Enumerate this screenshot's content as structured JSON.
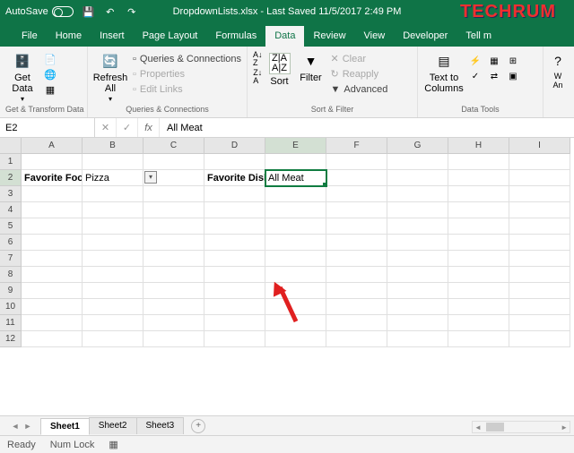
{
  "title": {
    "autosave": "AutoSave",
    "filename": "DropdownLists.xlsx - Last Saved 11/5/2017 2:49 PM"
  },
  "watermark": "TECHRUM",
  "tabs": [
    "File",
    "Home",
    "Insert",
    "Page Layout",
    "Formulas",
    "Data",
    "Review",
    "View",
    "Developer",
    "Tell m"
  ],
  "activeTab": "Data",
  "ribbon": {
    "transform": {
      "label": "Get & Transform Data",
      "get": "Get\nData"
    },
    "queries": {
      "label": "Queries & Connections",
      "refresh": "Refresh\nAll",
      "items": [
        "Queries & Connections",
        "Properties",
        "Edit Links"
      ]
    },
    "sort": {
      "label": "Sort & Filter",
      "sort": "Sort",
      "filter": "Filter",
      "clear": "Clear",
      "reapply": "Reapply",
      "adv": "Advanced"
    },
    "tools": {
      "label": "Data Tools",
      "t2c": "Text to\nColumns"
    },
    "what": "W\nAn"
  },
  "namebox": "E2",
  "formula": "All Meat",
  "columns": [
    "A",
    "B",
    "C",
    "D",
    "E",
    "F",
    "G",
    "H",
    "I"
  ],
  "activeCol": "E",
  "activeRow": 2,
  "rows": 12,
  "cells": {
    "A2": "Favorite Food",
    "B2": "Pizza",
    "D2": "Favorite Dish",
    "E2": "All Meat"
  },
  "sheets": [
    "Sheet1",
    "Sheet2",
    "Sheet3"
  ],
  "activeSheet": "Sheet1",
  "status": {
    "ready": "Ready",
    "numlock": "Num Lock"
  }
}
